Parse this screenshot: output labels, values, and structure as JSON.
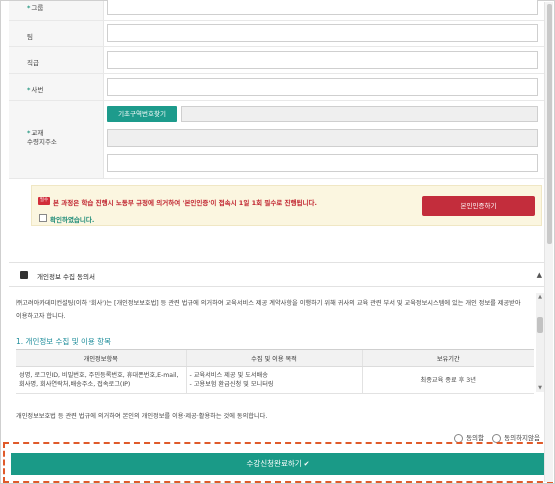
{
  "form": {
    "group_label": "그룹",
    "team_label": "팀",
    "position_label": "직급",
    "employee_no_label": "사번",
    "address_label_line1": "교재",
    "address_label_line2": "수령지주소",
    "zip_button_label": "기초구역번호찾기"
  },
  "notice": {
    "tag": "필수",
    "text": "본 과정은 학습 진행시 노동부 규정에 의거하여 '본인인증'이 접속시 1일 1회 필수로 진행됩니다.",
    "checkbox_label": "확인하였습니다.",
    "verify_button": "본인인증하기"
  },
  "privacy": {
    "title": "개인정보 수집 동의서",
    "intro": "㈜고려아카데미컨설팅(이하 '회사')는 [개인정보보호법] 등 관련 법규에 의거하여 교육서비스 제공 계약사항을 이행하기 위해 귀사의 교육 관련 부서 및 교육정보시스템에 있는 개인 정보를 제공받아 이용하고자 합니다.",
    "section_title": "1. 개인정보 수집 및 이용 항목",
    "table": {
      "headers": [
        "개인정보항목",
        "수집 및 이용 목적",
        "보유기간"
      ],
      "rows": [
        {
          "items": "성명, 로그인ID, 비밀번호, 주민등록번호, 휴대폰번호,E-mail, 회사명, 회사연락처,배송주소, 접속로그(IP)",
          "purpose_line1": "- 교육서비스 제공 및 도서배송",
          "purpose_line2": "- 고용보험 환급신청 및 모니터링",
          "period": "최종교육 종료 후 3년"
        }
      ]
    },
    "agree_statement": "개인정보보호법 등 관련 법규에 의거하여 본인의 개인정보를 이용·제공·활용하는 것에 동의합니다.",
    "agree_option": "동의함",
    "disagree_option": "동의하지않음"
  },
  "submit": {
    "label": "수강신청완료하기",
    "icon": "check-icon"
  }
}
